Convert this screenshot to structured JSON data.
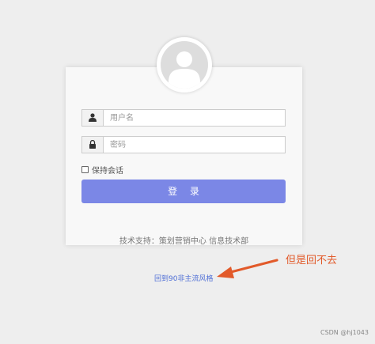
{
  "login": {
    "username_placeholder": "用户名",
    "password_placeholder": "密码",
    "remember_label": "保持会话",
    "login_button_label": "登 录",
    "support_text": "技术支持：策划营销中心 信息技术部"
  },
  "footer": {
    "back_link_label": "回到90非主流风格"
  },
  "annotation": {
    "text": "但是回不去"
  },
  "watermark": {
    "text": "CSDN @hj1043"
  },
  "icons": {
    "avatar": "user-avatar-icon",
    "username": "user-icon",
    "password": "lock-icon",
    "arrow": "arrow-left-icon"
  },
  "colors": {
    "button": "#7b87e6",
    "link": "#4f6fd6",
    "annotation": "#e25a2a",
    "background": "#eeeeee"
  }
}
